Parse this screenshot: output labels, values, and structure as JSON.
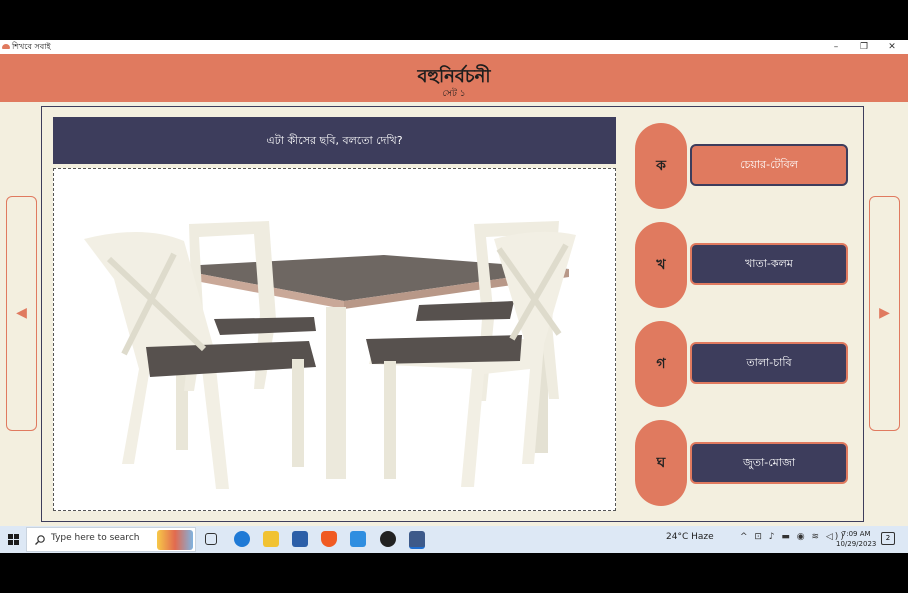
{
  "window": {
    "title": "শিখবে সবাই",
    "minimize": "–",
    "restore": "❐",
    "close": "✕"
  },
  "header": {
    "title": "বহুনির্বচনী",
    "subtitle": "সেট ১"
  },
  "question": {
    "text": "এটা কীসের ছবি, বলতো দেখি?",
    "image_alt": "dining table with four chairs"
  },
  "options": [
    {
      "letter": "ক",
      "label": "চেয়ার-টেবিল",
      "selected": true
    },
    {
      "letter": "খ",
      "label": "খাতা-কলম",
      "selected": false
    },
    {
      "letter": "গ",
      "label": "তালা-চাবি",
      "selected": false
    },
    {
      "letter": "ঘ",
      "label": "জুতা-মোজা",
      "selected": false
    }
  ],
  "nav": {
    "prev": "◀",
    "next": "▶"
  },
  "taskbar": {
    "search_placeholder": "Type here to search",
    "weather": "24°C  Haze",
    "time": "7:09 AM",
    "date": "10/29/2023",
    "tray_icons": "^ ⊡ ♪ ▬ ◉ ≋ ◁))",
    "notification_count": "2"
  },
  "colors": {
    "accent": "#e07a5f",
    "navy": "#3d3d5c",
    "background": "#f3efdf"
  }
}
